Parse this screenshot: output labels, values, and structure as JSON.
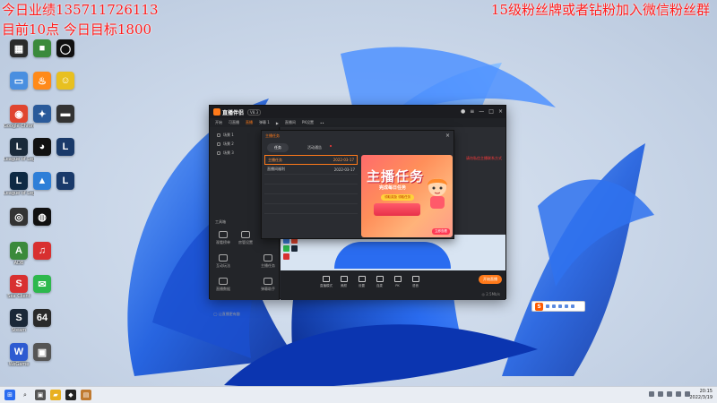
{
  "overlay": {
    "line1": "今日业绩13571172611​3",
    "line2": "目前10点 今日目标1800",
    "right": "15级粉丝牌或者钻粉加入微信粉丝群"
  },
  "desktop_icons": [
    {
      "label": "",
      "color": "#2b2b2b",
      "glyph": "▦"
    },
    {
      "label": "此电脑",
      "color": "#3a7bd5",
      "glyph": "▭"
    },
    {
      "label": "回收站",
      "color": "#4a8fe0",
      "glyph": "♻"
    },
    {
      "label": "Google Chrome",
      "color": "#e0452f",
      "glyph": "◉"
    },
    {
      "label": "League of Legends",
      "color": "#1a2a3a",
      "glyph": "L"
    },
    {
      "label": "League of Legends",
      "color": "#0e2a44",
      "glyph": "L"
    },
    {
      "label": "ADB",
      "color": "#3b8a3b",
      "glyph": "A"
    },
    {
      "label": "Sea Client",
      "color": "#d83030",
      "glyph": "S"
    },
    {
      "label": "Steam",
      "color": "#1b2838",
      "glyph": "S"
    },
    {
      "label": "WeGame",
      "color": "#2e5bd1",
      "glyph": "W"
    }
  ],
  "app": {
    "name": "直播伴侣",
    "version": "V8.3",
    "menu": [
      "开始",
      "可直播",
      "直播",
      "弹幕 1",
      "▶",
      "直播间",
      "PK设置",
      "••"
    ],
    "scenes": [
      "场景 1",
      "场景 2",
      "场景 3"
    ],
    "tools_title": "工具箱",
    "tools": [
      "观看榜单",
      "房管设置",
      "互动玩法",
      "主播任务",
      "直播数据",
      "弹幕助手"
    ],
    "sidebar_footer": "◯ 让直播更有趣",
    "preview_link": "请勿私信主播联系方式",
    "bottom_buttons": [
      "直播模式",
      "美颜",
      "设置",
      "连麦",
      "PK",
      "语音",
      "音效"
    ],
    "start_label": "开始直播",
    "bottom_status": "◎ 2.5Mb/s"
  },
  "dialog": {
    "title": "主播任务",
    "tabs": [
      "任务",
      "活动通告"
    ],
    "close": "×",
    "rows": [
      {
        "name": "主播任务",
        "date": "2022-03-17"
      },
      {
        "name": "直播间福利",
        "date": "2022-03-17"
      }
    ],
    "banner": {
      "title": "主播任务",
      "subtitle": "完成每日任务",
      "button": "领取奖励 领取任务",
      "go": "立即查看"
    }
  },
  "sogou": {
    "label": "S"
  },
  "taskbar": {
    "time": "20:15",
    "date": "2022/3/19"
  }
}
